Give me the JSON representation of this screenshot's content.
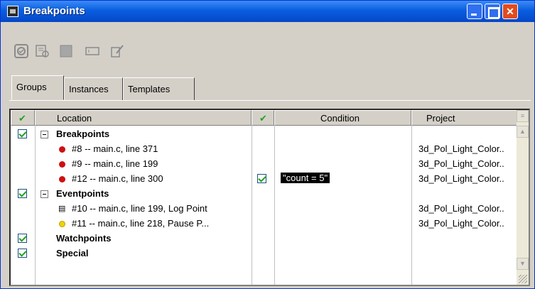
{
  "window": {
    "title": "Breakpoints"
  },
  "toolbar": {
    "icons": [
      "enable-icon",
      "view-source-icon",
      "delete-icon",
      "properties-icon",
      "edit-icon"
    ]
  },
  "tabs": [
    {
      "label": "Groups"
    },
    {
      "label": "Instances"
    },
    {
      "label": "Templates"
    }
  ],
  "grid": {
    "columns": {
      "location": "Location",
      "condition": "Condition",
      "project": "Project"
    },
    "groups": [
      {
        "label": "Breakpoints",
        "rows": [
          {
            "location": "#8 -- main.c, line 371",
            "condition": "",
            "project": "3d_Pol_Light_Color.."
          },
          {
            "location": "#9 -- main.c, line 199",
            "condition": "",
            "project": "3d_Pol_Light_Color.."
          },
          {
            "location": "#12 -- main.c, line 300",
            "condition": "\"count = 5\"",
            "project": "3d_Pol_Light_Color.."
          }
        ]
      },
      {
        "label": "Eventpoints",
        "rows": [
          {
            "location": "#10 -- main.c, line 199, Log Point",
            "project": "3d_Pol_Light_Color.."
          },
          {
            "location": "#11 -- main.c, line 218, Pause P...",
            "project": "3d_Pol_Light_Color.."
          }
        ]
      },
      {
        "label": "Watchpoints",
        "rows": []
      },
      {
        "label": "Special",
        "rows": []
      }
    ]
  },
  "colors": {
    "breakpoint": "#cc1111",
    "pausepoint": "#f2d200",
    "titlebar": "#0a5ee0"
  }
}
